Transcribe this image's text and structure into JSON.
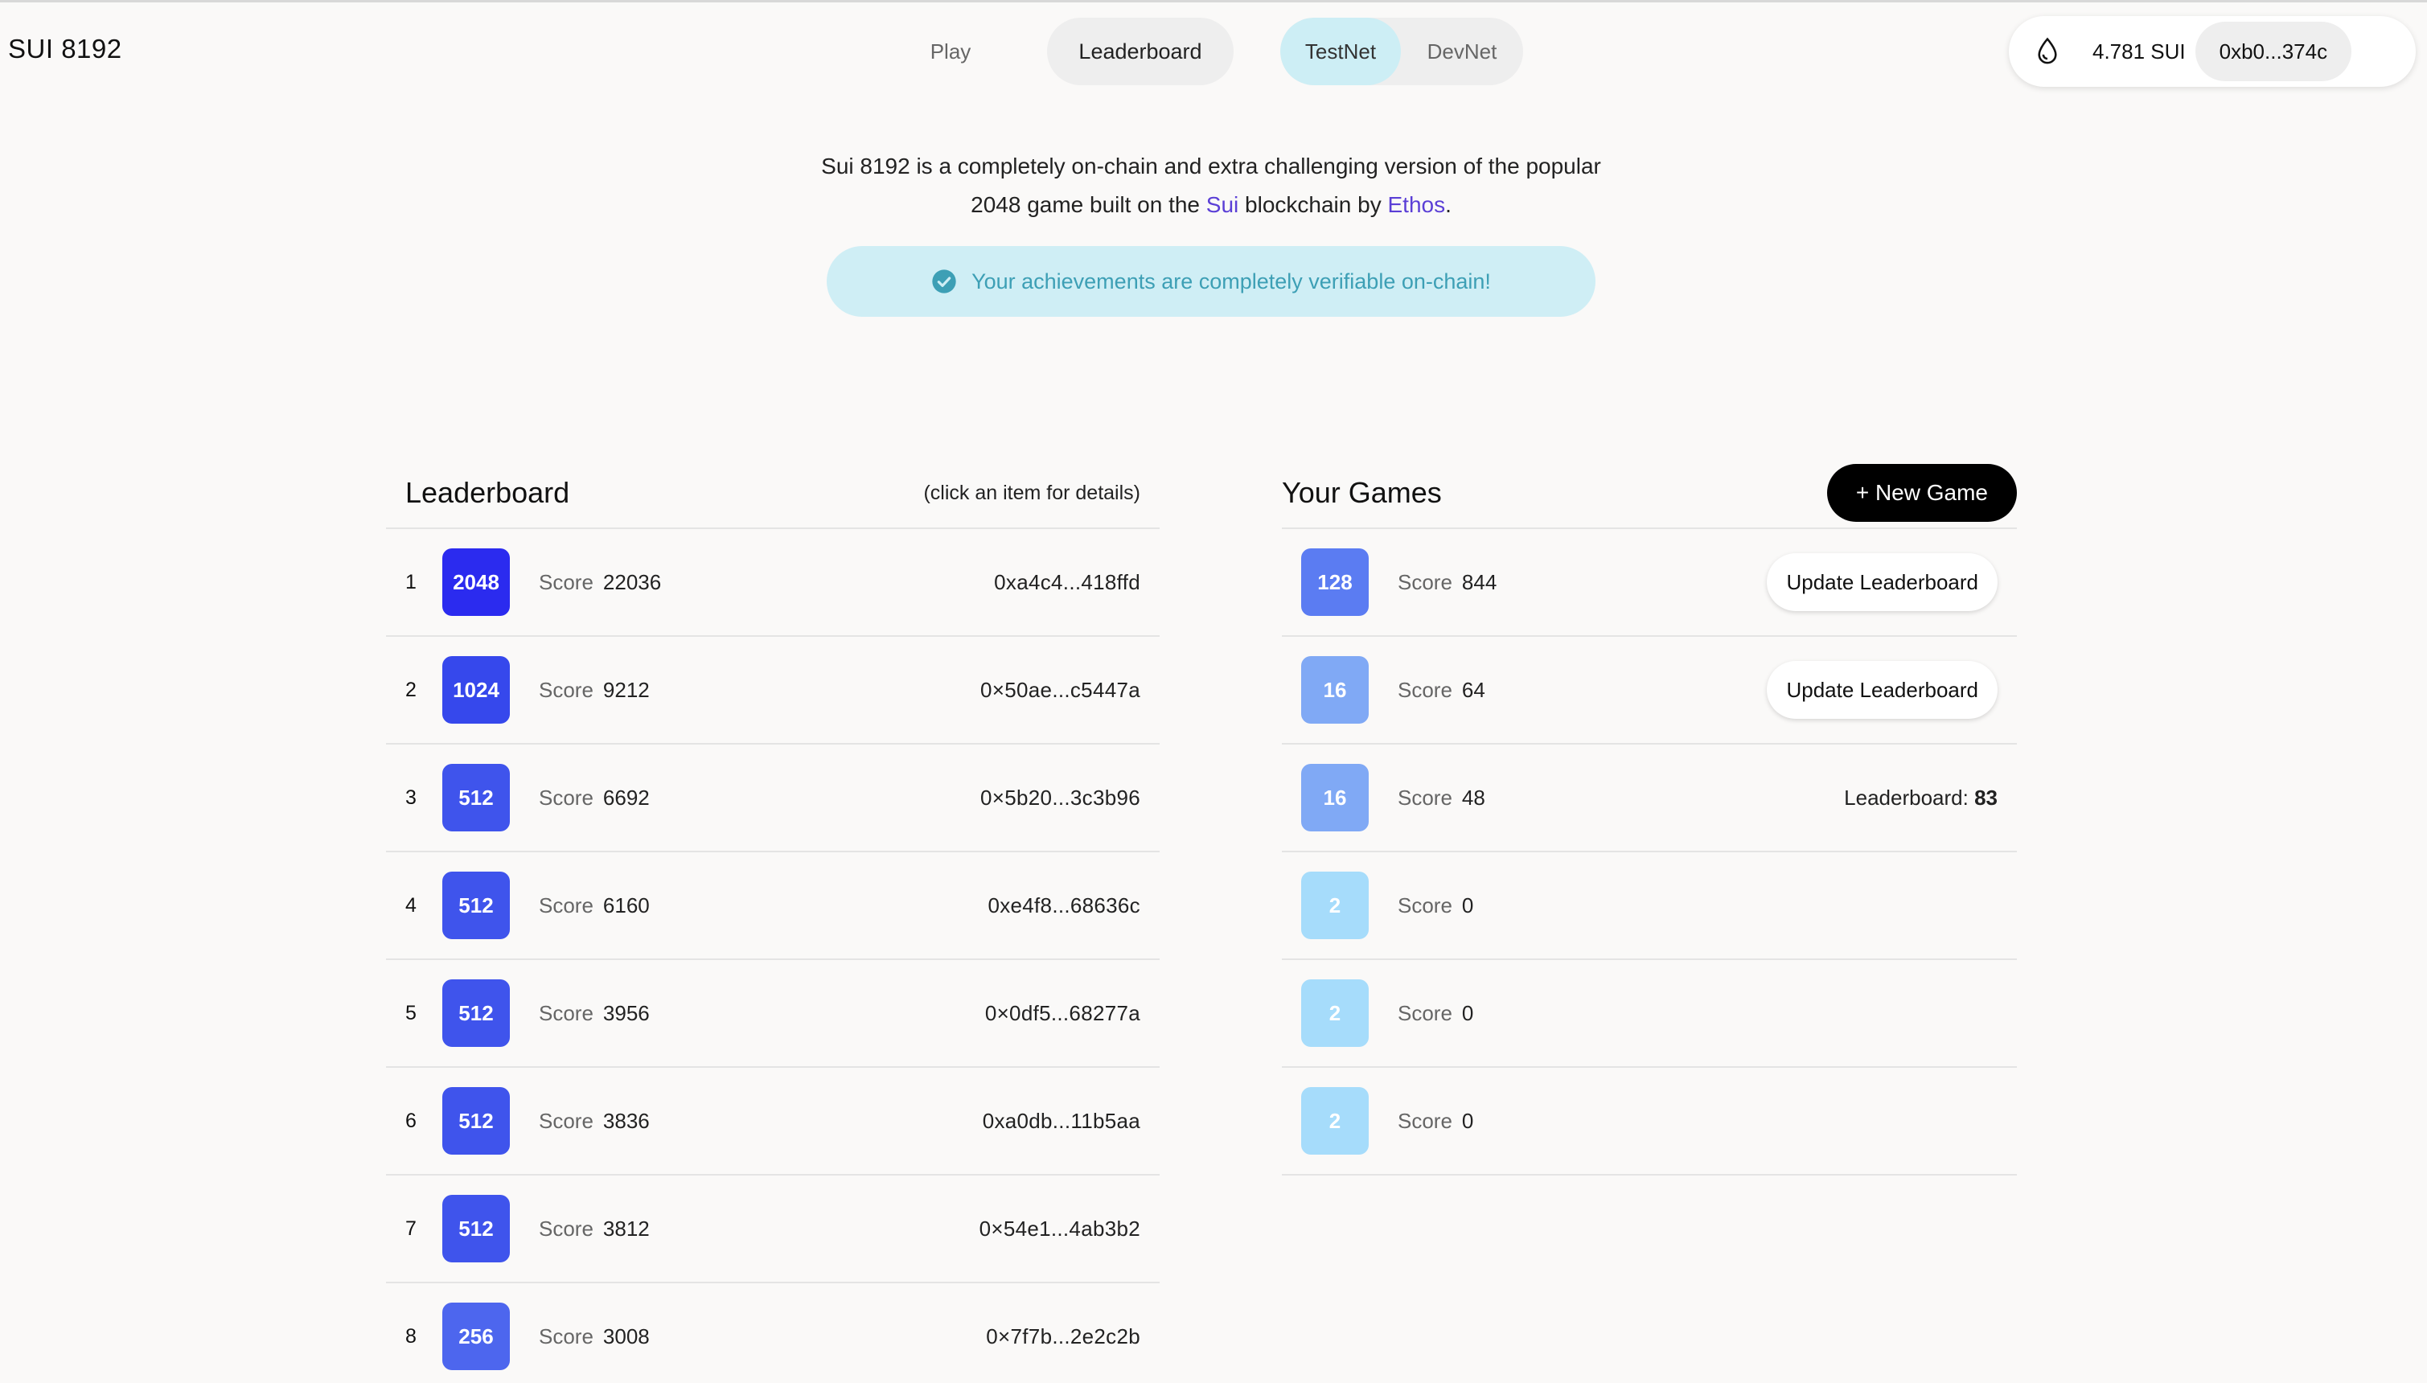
{
  "header": {
    "brand_prefix": "SUI",
    "brand_num": "8192",
    "nav_play": "Play",
    "nav_leaderboard": "Leaderboard",
    "net_testnet": "TestNet",
    "net_devnet": "DevNet",
    "balance": "4.781 SUI",
    "address": "0xb0...374c"
  },
  "intro": {
    "text_1": "Sui 8192 is a completely on-chain and extra challenging version of the popular 2048 game built on the",
    "link_sui": "Sui",
    "text_2": "blockchain by",
    "link_ethos": "Ethos",
    "text_3": ".",
    "banner": "Your achievements are completely verifiable on-chain!"
  },
  "leaderboard": {
    "title": "Leaderboard",
    "hint": "(click an item for details)",
    "score_label": "Score",
    "rows": [
      {
        "rank": "1",
        "tile": "2048",
        "score": "22036",
        "addr": "0xa4c4...418ffd",
        "color": "#2b2bef"
      },
      {
        "rank": "2",
        "tile": "1024",
        "score": "9212",
        "addr": "0×50ae...c5447a",
        "color": "#3648ec"
      },
      {
        "rank": "3",
        "tile": "512",
        "score": "6692",
        "addr": "0×5b20...3c3b96",
        "color": "#3f54ec"
      },
      {
        "rank": "4",
        "tile": "512",
        "score": "6160",
        "addr": "0xe4f8...68636c",
        "color": "#3f54ec"
      },
      {
        "rank": "5",
        "tile": "512",
        "score": "3956",
        "addr": "0×0df5...68277a",
        "color": "#3f54ec"
      },
      {
        "rank": "6",
        "tile": "512",
        "score": "3836",
        "addr": "0xa0db...11b5aa",
        "color": "#3f54ec"
      },
      {
        "rank": "7",
        "tile": "512",
        "score": "3812",
        "addr": "0×54e1...4ab3b2",
        "color": "#3f54ec"
      },
      {
        "rank": "8",
        "tile": "256",
        "score": "3008",
        "addr": "0×7f7b...2e2c2b",
        "color": "#4d66ee"
      }
    ]
  },
  "your_games": {
    "title": "Your Games",
    "new_game": "+ New Game",
    "score_label": "Score",
    "update_label": "Update Leaderboard",
    "lb_label": "Leaderboard:",
    "rows": [
      {
        "tile": "128",
        "score": "844",
        "action": "update",
        "color": "#5b7cf2"
      },
      {
        "tile": "16",
        "score": "64",
        "action": "update",
        "color": "#80a9f5"
      },
      {
        "tile": "16",
        "score": "48",
        "action": "position",
        "position": "83",
        "color": "#80a9f5"
      },
      {
        "tile": "2",
        "score": "0",
        "action": "none",
        "color": "#a6dcfb"
      },
      {
        "tile": "2",
        "score": "0",
        "action": "none",
        "color": "#a6dcfb"
      },
      {
        "tile": "2",
        "score": "0",
        "action": "none",
        "color": "#a6dcfb"
      }
    ]
  }
}
